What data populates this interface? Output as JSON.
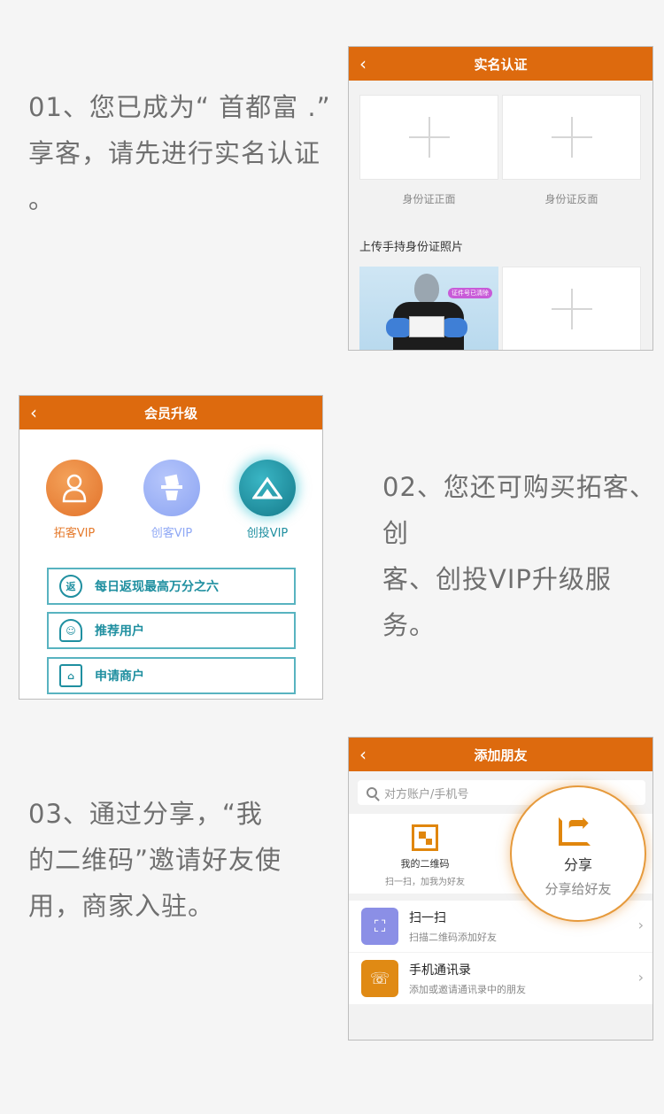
{
  "step1": {
    "lines": [
      "01、您已成为“ 首都富 .”",
      "享客，请先进行实名认证",
      "。"
    ],
    "screen": {
      "title": "实名认证",
      "back_icon": "chevron-left-icon",
      "front_label": "身份证正面",
      "back_label": "身份证反面",
      "handheld_label": "上传手持身份证照片",
      "photo_badge": "证件号已清除"
    }
  },
  "step2": {
    "lines": [
      "02、您还可购买拓客、创",
      "客、创投VIP升级服务。"
    ],
    "screen": {
      "title": "会员升级",
      "tiers": [
        {
          "label": "拓客VIP",
          "color": "#e57a2c"
        },
        {
          "label": "创客VIP",
          "color": "#8fa8f5"
        },
        {
          "label": "创投VIP",
          "color": "#1f8fa0"
        }
      ],
      "buttons": [
        {
          "label": "每日返现最高万分之六",
          "icon": "返"
        },
        {
          "label": "推荐用户",
          "icon": "user-icon"
        },
        {
          "label": "申请商户",
          "icon": "store-icon"
        }
      ]
    }
  },
  "step3": {
    "lines": [
      "03、通过分享，“我",
      "的二维码”邀请好友使",
      "用，商家入驻。"
    ],
    "screen": {
      "title": "添加朋友",
      "search_placeholder": "对方账户/手机号",
      "qr_title": "我的二维码",
      "qr_sub": "扫一扫，加我为好友",
      "share_title": "分享",
      "share_sub": "分享给好友",
      "items": [
        {
          "title": "扫一扫",
          "sub": "扫描二维码添加好友",
          "color": "#8b8fe6"
        },
        {
          "title": "手机通讯录",
          "sub": "添加或邀请通讯录中的朋友",
          "color": "#e08a14"
        }
      ]
    }
  }
}
